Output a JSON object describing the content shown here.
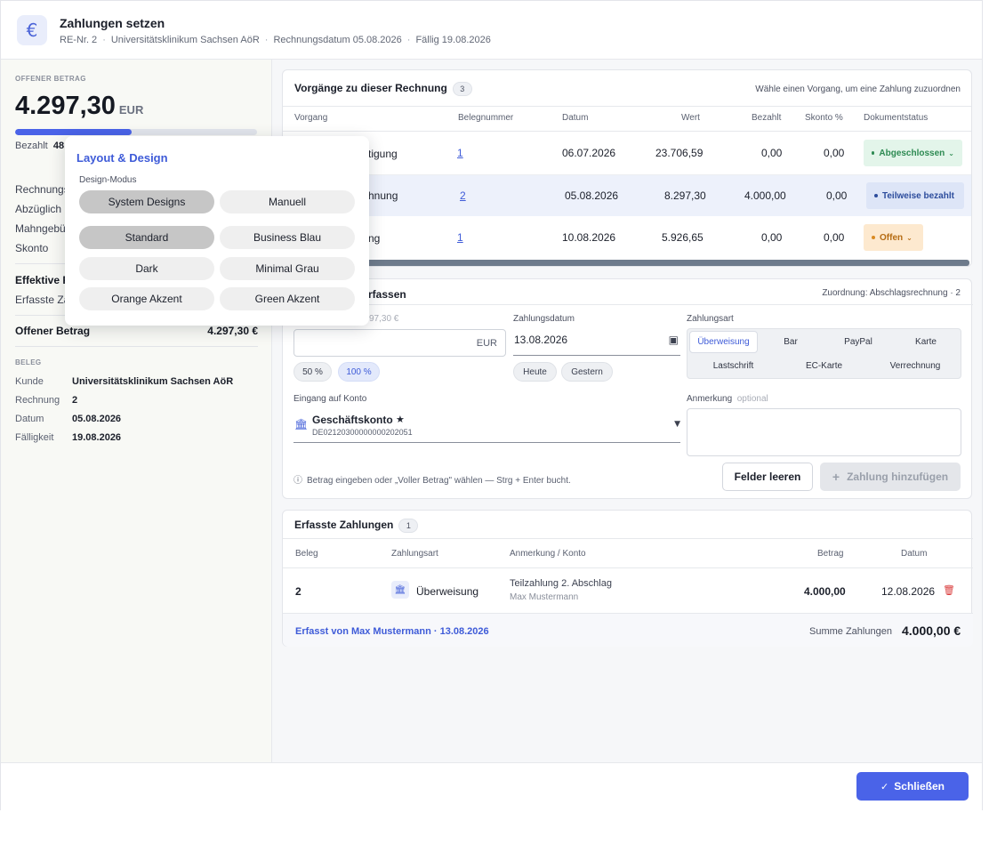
{
  "header": {
    "title": "Zahlungen setzen",
    "icon": "euro-icon",
    "invoice_no": "RE-Nr. 2",
    "customer": "Universitätsklinikum Sachsen AöR",
    "invoice_date": "Rechnungsdatum 05.08.2026",
    "due": "Fällig 19.08.2026"
  },
  "summary": {
    "open_label": "OFFENER BETRAG",
    "open_amount": "4.297,30",
    "currency": "EUR",
    "paid_fraction": 0.48,
    "paid_label": "Bezahlt",
    "paid_value": "48",
    "rows": [
      {
        "label": "Rechnungs"
      },
      {
        "label": "Abzüglich"
      },
      {
        "label": "Mahngebü"
      },
      {
        "label": "Skonto"
      }
    ],
    "effective_label": "Effektive F",
    "captured_label": "Erfasste Za",
    "open_total_label": "Offener Betrag",
    "open_total_value": "4.297,30 €",
    "beleg_label": "BELEG",
    "beleg": {
      "kunde_k": "Kunde",
      "kunde_v": "Universitätsklinikum Sachsen AöR",
      "rechnung_k": "Rechnung",
      "rechnung_v": "2",
      "datum_k": "Datum",
      "datum_v": "05.08.2026",
      "faellig_k": "Fälligkeit",
      "faellig_v": "19.08.2026"
    }
  },
  "vorgaenge": {
    "title": "Vorgänge zu dieser Rechnung",
    "count": "3",
    "hint": "Wähle einen Vorgang, um eine Zahlung zuzuordnen",
    "columns": [
      "Vorgang",
      "Belegnummer",
      "Datum",
      "Wert",
      "Bezahlt",
      "Skonto %",
      "Dokumentstatus"
    ],
    "rows": [
      {
        "vorgang": "tigung",
        "beleg": "1",
        "datum": "06.07.2026",
        "wert": "23.706,59",
        "bezahlt": "0,00",
        "skonto": "0,00",
        "status": "Abgeschlossen"
      },
      {
        "vorgang": "hnung",
        "beleg": "2",
        "datum": "05.08.2026",
        "wert": "8.297,30",
        "bezahlt": "4.000,00",
        "skonto": "0,00",
        "status": "Teilweise bezahlt"
      },
      {
        "vorgang": "ng",
        "beleg": "1",
        "datum": "10.08.2026",
        "wert": "5.926,65",
        "bezahlt": "0,00",
        "skonto": "0,00",
        "status": "Offen"
      }
    ]
  },
  "erfassen": {
    "title": "rfassen",
    "assignment": "Zuordnung: Abschlagsrechnung · 2",
    "amount_label": "97,30 €",
    "amount_value": "",
    "amount_currency": "EUR",
    "chip_50": "50 %",
    "chip_100": "100 %",
    "date_label": "Zahlungsdatum",
    "date_value": "13.08.2026",
    "today": "Heute",
    "yesterday": "Gestern",
    "method_label": "Zahlungsart",
    "methods": [
      "Überweisung",
      "Bar",
      "PayPal",
      "Karte",
      "Lastschrift",
      "EC-Karte",
      "Verrechnung"
    ],
    "account_label": "Eingang auf Konto",
    "account_name": "Geschäftskonto",
    "account_iban": "DE02120300000000202051",
    "note_label": "Anmerkung",
    "note_optional": "optional",
    "help": "Betrag eingeben oder „Voller Betrag\" wählen — Strg + Enter bucht.",
    "clear_btn": "Felder leeren",
    "add_btn": "Zahlung hinzufügen"
  },
  "zahlungen": {
    "title": "Erfasste Zahlungen",
    "count": "1",
    "columns": [
      "Beleg",
      "Zahlungsart",
      "Anmerkung / Konto",
      "Betrag",
      "Datum"
    ],
    "rows": [
      {
        "beleg": "2",
        "art": "Überweisung",
        "anmerkung": "Teilzahlung 2. Abschlag",
        "konto": "Max Mustermann",
        "betrag": "4.000,00",
        "datum": "12.08.2026"
      }
    ],
    "captured_by": "Erfasst von Max  Mustermann · 13.08.2026",
    "sum_label": "Summe Zahlungen",
    "sum_value": "4.000,00 €"
  },
  "footer": {
    "close_btn": "Schließen"
  },
  "popover": {
    "title": "Layout & Design",
    "mode_label": "Design-Modus",
    "modes": [
      "System Designs",
      "Manuell"
    ],
    "themes": [
      "Standard",
      "Business Blau",
      "Dark",
      "Minimal Grau",
      "Orange Akzent",
      "Green Akzent"
    ]
  },
  "colors": {
    "accent": "#4a63e8",
    "status_done": "#2d8a52",
    "status_partial": "#2c4c9c",
    "status_open": "#b56b12",
    "delete": "#d93a3a"
  }
}
